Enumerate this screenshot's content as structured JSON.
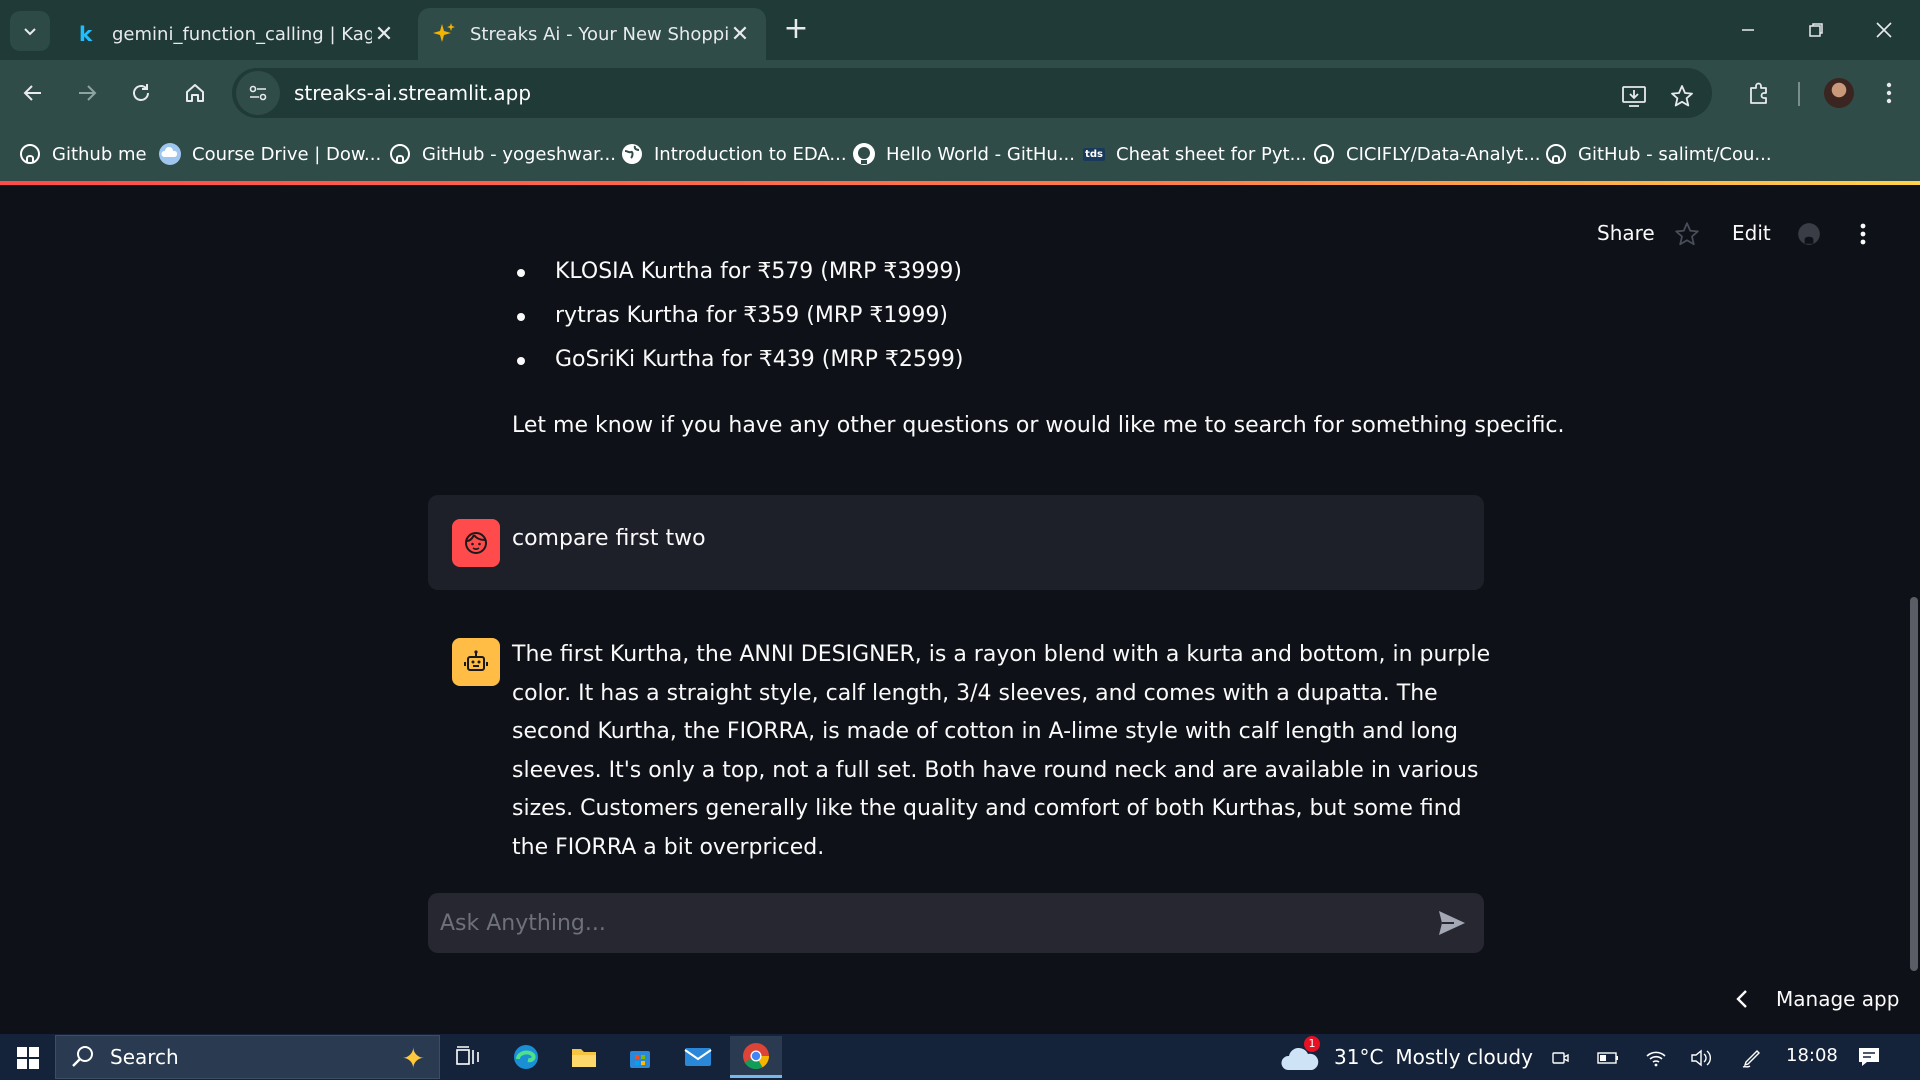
{
  "browser": {
    "tabs": [
      {
        "title": "gemini_function_calling | Kaggle",
        "favicon": "kaggle-k-icon",
        "active": false
      },
      {
        "title": "Streaks Ai - Your New Shopping Assistant",
        "favicon": "sparkle-icon",
        "active": true
      }
    ],
    "new_tab_label": "+",
    "url": "streaks-ai.streamlit.app",
    "bookmarks": [
      {
        "label": "Github me",
        "icon": "github-icon"
      },
      {
        "label": "Course Drive | Dow...",
        "icon": "cloud-icon"
      },
      {
        "label": "GitHub - yogeshwar...",
        "icon": "github-icon"
      },
      {
        "label": "Introduction to EDA...",
        "icon": "globe-icon"
      },
      {
        "label": "Hello World - GitHu...",
        "icon": "github-octocat-icon"
      },
      {
        "label": "Cheat sheet for Pyt...",
        "icon": "tds-icon"
      },
      {
        "label": "CICIFLY/Data-Analyt...",
        "icon": "github-icon"
      },
      {
        "label": "GitHub - salimt/Cou...",
        "icon": "github-icon"
      }
    ],
    "tds_icon_text": "tds"
  },
  "app": {
    "header": {
      "share": "Share",
      "edit": "Edit"
    },
    "previous_items": [
      "KLOSIA Kurtha for ₹579 (MRP ₹3999)",
      "rytras Kurtha for ₹359 (MRP ₹1999)",
      "GoSriKi Kurtha for ₹439 (MRP ₹2599)"
    ],
    "previous_closing": "Let me know if you have any other questions or would like me to search for something specific.",
    "user_message": "compare first two",
    "assistant_message": "The first Kurtha, the ANNI DESIGNER, is a rayon blend with a kurta and bottom, in purple color. It has a straight style, calf length, 3/4 sleeves, and comes with a dupatta. The second Kurtha, the FIORRA, is made of cotton in A-lime style with calf length and long sleeves. It's only a top, not a full set. Both have round neck and are available in various sizes. Customers generally like the quality and comfort of both Kurthas, but some find the FIORRA a bit overpriced.",
    "chat_input": {
      "placeholder": "Ask Anything...",
      "value": ""
    },
    "manage_app": "Manage app",
    "colors": {
      "background": "#0e1117",
      "user_avatar": "#ff4b4b",
      "bot_avatar": "#ffbd45",
      "user_bubble": "#1e2029"
    }
  },
  "taskbar": {
    "search_label": "Search",
    "weather": {
      "temp": "31°C",
      "condition": "Mostly cloudy",
      "badge": "1"
    },
    "time": "18:08"
  }
}
